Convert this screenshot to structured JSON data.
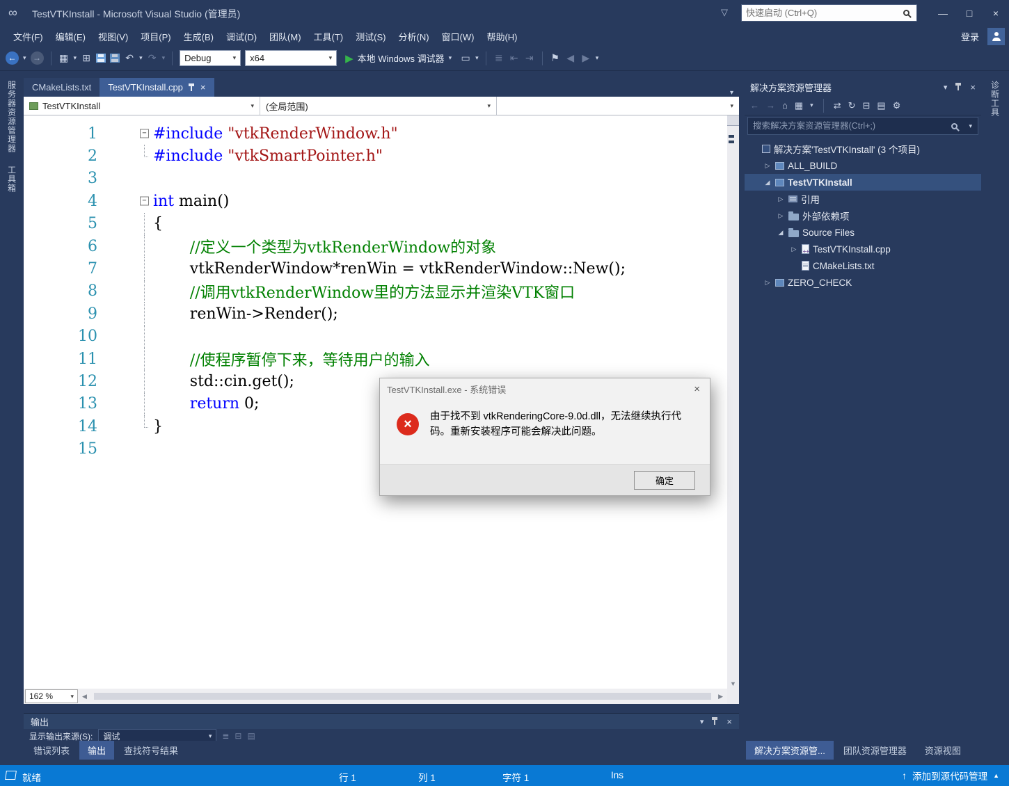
{
  "window": {
    "title": "TestVTKInstall - Microsoft Visual Studio (管理员)",
    "quick_launch": "快速启动 (Ctrl+Q)",
    "sign_in": "登录"
  },
  "menus": [
    "文件(F)",
    "编辑(E)",
    "视图(V)",
    "项目(P)",
    "生成(B)",
    "调试(D)",
    "团队(M)",
    "工具(T)",
    "测试(S)",
    "分析(N)",
    "窗口(W)",
    "帮助(H)"
  ],
  "toolbar": {
    "config": "Debug",
    "platform": "x64",
    "start_label": "本地 Windows 调试器"
  },
  "left_tabs": [
    "服务器资源管理器",
    "工具箱"
  ],
  "right_tabs": [
    "诊断工具"
  ],
  "editor": {
    "tabs": [
      {
        "label": "CMakeLists.txt",
        "active": false
      },
      {
        "label": "TestVTKInstall.cpp",
        "active": true
      }
    ],
    "nav": {
      "project": "TestVTKInstall",
      "scope": "(全局范围)"
    },
    "zoom": "162 %",
    "lines": [
      {
        "n": "1",
        "fold": "open",
        "guide": null,
        "indent": 0,
        "seg": [
          [
            "#include ",
            "pp"
          ],
          [
            "\"vtkRenderWindow.h\"",
            "str"
          ]
        ]
      },
      {
        "n": "2",
        "fold": null,
        "guide": "end",
        "indent": 0,
        "seg": [
          [
            "#include ",
            "pp"
          ],
          [
            "\"vtkSmartPointer.h\"",
            "str"
          ]
        ]
      },
      {
        "n": "3",
        "fold": null,
        "guide": null,
        "indent": 0,
        "seg": []
      },
      {
        "n": "4",
        "fold": "open",
        "guide": null,
        "indent": 0,
        "seg": [
          [
            "int",
            "kw"
          ],
          [
            " main()",
            "plain"
          ]
        ]
      },
      {
        "n": "5",
        "fold": null,
        "guide": "line",
        "indent": 0,
        "seg": [
          [
            "{",
            "plain"
          ]
        ]
      },
      {
        "n": "6",
        "fold": null,
        "guide": "line",
        "indent": 4,
        "seg": [
          [
            "//定义一个类型为vtkRenderWindow的对象",
            "com"
          ]
        ]
      },
      {
        "n": "7",
        "fold": null,
        "guide": "line",
        "indent": 4,
        "seg": [
          [
            "vtkRenderWindow*renWin = vtkRenderWindow::New();",
            "plain"
          ]
        ]
      },
      {
        "n": "8",
        "fold": null,
        "guide": "line",
        "indent": 4,
        "seg": [
          [
            "//调用vtkRenderWindow里的方法显示并渲染VTK窗口",
            "com"
          ]
        ]
      },
      {
        "n": "9",
        "fold": null,
        "guide": "line",
        "indent": 4,
        "seg": [
          [
            "renWin->Render();",
            "plain"
          ]
        ]
      },
      {
        "n": "10",
        "fold": null,
        "guide": "line",
        "indent": 4,
        "seg": []
      },
      {
        "n": "11",
        "fold": null,
        "guide": "line",
        "indent": 4,
        "seg": [
          [
            "//使程序暂停下来，等待用户的输入",
            "com"
          ]
        ]
      },
      {
        "n": "12",
        "fold": null,
        "guide": "line",
        "indent": 4,
        "seg": [
          [
            "std::cin.get();",
            "plain"
          ]
        ]
      },
      {
        "n": "13",
        "fold": null,
        "guide": "line",
        "indent": 4,
        "seg": [
          [
            "return",
            "kw"
          ],
          [
            " 0;",
            "plain"
          ]
        ]
      },
      {
        "n": "14",
        "fold": null,
        "guide": "end",
        "indent": 0,
        "seg": [
          [
            "}",
            "plain"
          ]
        ]
      },
      {
        "n": "15",
        "fold": null,
        "guide": null,
        "indent": 0,
        "seg": []
      }
    ]
  },
  "solution_explorer": {
    "title": "解决方案资源管理器",
    "search_placeholder": "搜索解决方案资源管理器(Ctrl+;)",
    "items": [
      {
        "key": "solution",
        "label": "解决方案'TestVTKInstall' (3 个项目)",
        "indent": 0,
        "icon": "solution",
        "arrow": null,
        "bold": false,
        "selected": false
      },
      {
        "key": "all-build",
        "label": "ALL_BUILD",
        "indent": 1,
        "icon": "project",
        "arrow": "collapsed",
        "bold": false,
        "selected": false
      },
      {
        "key": "testvtkinstall",
        "label": "TestVTKInstall",
        "indent": 1,
        "icon": "project",
        "arrow": "expanded",
        "bold": true,
        "selected": true
      },
      {
        "key": "references",
        "label": "引用",
        "indent": 2,
        "icon": "references",
        "arrow": "collapsed",
        "bold": false,
        "selected": false
      },
      {
        "key": "external-deps",
        "label": "外部依赖项",
        "indent": 2,
        "icon": "folder",
        "arrow": "collapsed",
        "bold": false,
        "selected": false
      },
      {
        "key": "source-files",
        "label": "Source Files",
        "indent": 2,
        "icon": "folder",
        "arrow": "expanded",
        "bold": false,
        "selected": false
      },
      {
        "key": "cpp-file",
        "label": "TestVTKInstall.cpp",
        "indent": 3,
        "icon": "cpp",
        "arrow": "collapsed",
        "bold": false,
        "selected": false
      },
      {
        "key": "cmakelists",
        "label": "CMakeLists.txt",
        "indent": 3,
        "icon": "txt",
        "arrow": null,
        "bold": false,
        "selected": false
      },
      {
        "key": "zero-check",
        "label": "ZERO_CHECK",
        "indent": 1,
        "icon": "project",
        "arrow": "collapsed",
        "bold": false,
        "selected": false
      }
    ],
    "bottom_tabs": [
      "解决方案资源管...",
      "团队资源管理器",
      "资源视图"
    ]
  },
  "output_panel": {
    "title": "输出",
    "source_label": "显示输出来源(S):",
    "source_value": "调试",
    "tabs": [
      "错误列表",
      "输出",
      "查找符号结果"
    ]
  },
  "dialog": {
    "title": "TestVTKInstall.exe - 系统错误",
    "message": "由于找不到 vtkRenderingCore-9.0d.dll，无法继续执行代码。重新安装程序可能会解决此问题。",
    "ok": "确定"
  },
  "status": {
    "ready": "就绪",
    "line": "行 1",
    "col": "列 1",
    "char": "字符 1",
    "ins": "Ins",
    "add_source": "添加到源代码管理"
  },
  "icons": {
    "vs_logo": "∞",
    "notifications": "▽",
    "min": "—",
    "max": "□",
    "close": "×",
    "back": "←",
    "forward": "→",
    "caret": "▾",
    "new_project": "▦",
    "add_item": "⊞",
    "undo": "↶",
    "redo": "↷",
    "start": "▶",
    "monitor": "▭",
    "list": "≣",
    "step1": "⇤",
    "step2": "⇥",
    "bookmark": "⚑",
    "home": "⌂",
    "switch_view": "▦",
    "sync": "⇄",
    "refresh": "↻",
    "collapse_all": "⊟",
    "show_all": "▤",
    "wrench": "⚙",
    "scroll_down": "▼",
    "scroll_left": "◀",
    "scroll_right": "▶"
  },
  "colors": {
    "accent": "#0979D4",
    "error": "#DC2B1C",
    "chrome": "#283A5D"
  }
}
